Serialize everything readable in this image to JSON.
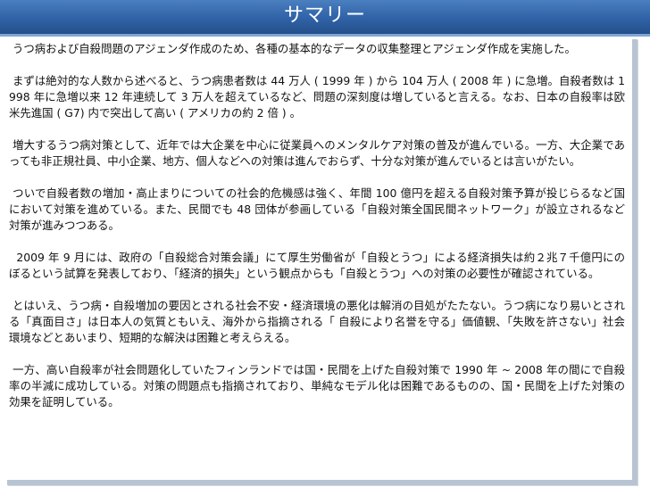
{
  "slide": {
    "title": "サマリー",
    "paragraphs": [
      " うつ病および自殺問題のアジェンダ作成のため、各種の基本的なデータの収集整理とアジェンダ作成を実施した。",
      " まずは絶対的な人数から述べると、うつ病患者数は 44 万人 ( 1999 年 ) から 104 万人 ( 2008 年 ) に急増。自殺者数は 1998 年に急増以来 12 年連続して 3 万人を超えているなど、問題の深刻度は増していると言える。なお、日本の自殺率は欧米先進国 ( G7) 内で突出して高い ( アメリカの約 2 倍 ) 。",
      " 増大するうつ病対策として、近年では大企業を中心に従業員へのメンタルケア対策の普及が進んでいる。一方、大企業であっても非正規社員、中小企業、地方、個人などへの対策は進んでおらず、十分な対策が進んでいるとは言いがたい。",
      " ついで自殺者数の増加・高止まりについての社会的危機感は強く、年間 100 億円を超える自殺対策予算が投じらるなど国において対策を進めている。また、民間でも 48 団体が参画している「自殺対策全国民間ネットワーク」が設立されるなど対策が進みつつある。",
      "  2009 年 9 月には、政府の「自殺総合対策会議」にて厚生労働省が「自殺とうつ」による経済損失は約２兆７千億円にのぼるという試算を発表しており、「経済的損失」という観点からも「自殺とうつ」への対策の必要性が確認されている。",
      " とはいえ、うつ病・自殺増加の要因とされる社会不安・経済環境の悪化は解消の目処がたたない。うつ病になり易いとされる「真面目さ」は日本人の気質ともいえ、海外から指摘される「 自殺により名誉を守る」価値観、「失敗を許さない」社会環境などとあいまり、短期的な解決は困難と考えらえる。",
      " 一方、高い自殺率が社会問題化していたフィンランドでは国・民間を上げた自殺対策で 1990 年 ~ 2008 年の間にで自殺率の半減に成功している。対策の問題点も指摘されており、単純なモデル化は困難であるものの、国・民間を上げた対策の効果を証明している。"
    ]
  }
}
